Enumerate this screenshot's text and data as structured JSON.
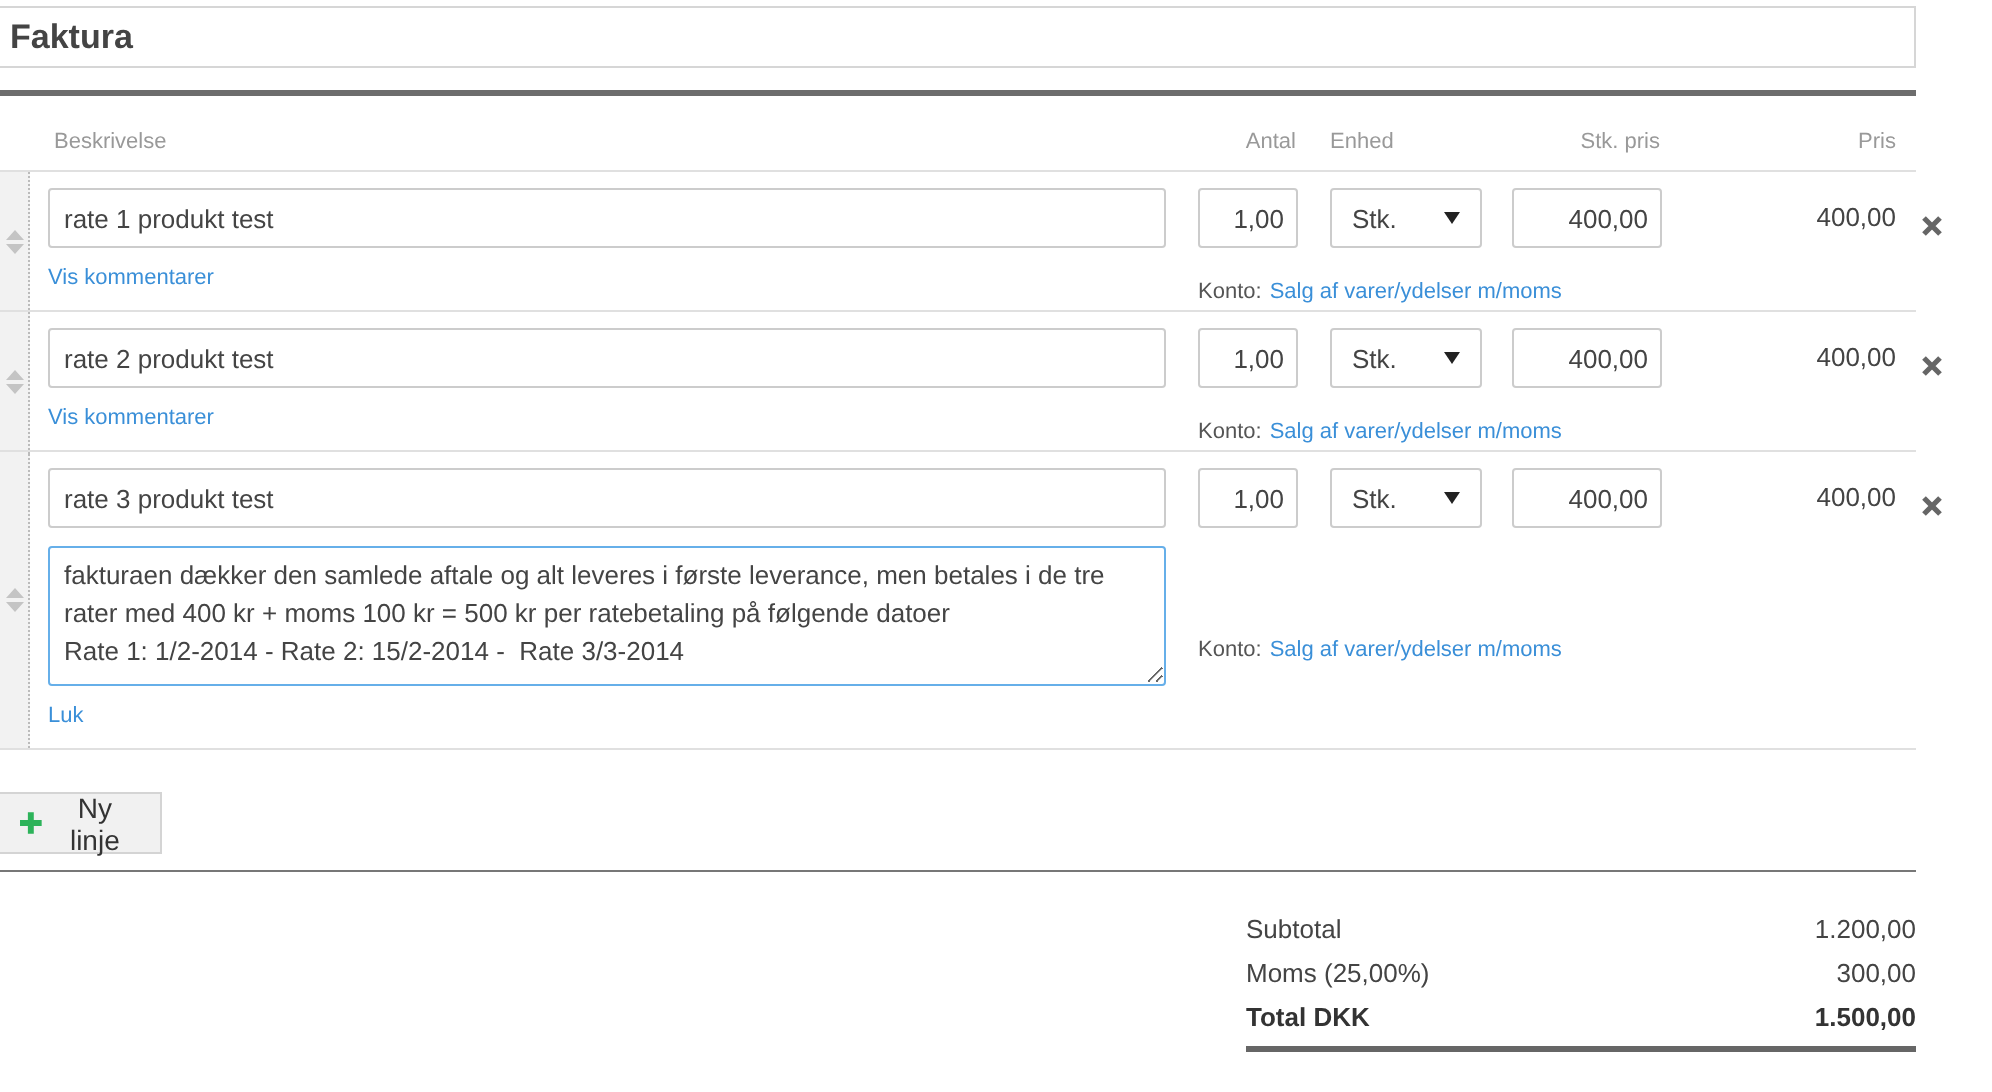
{
  "title_field": {
    "value": "Faktura"
  },
  "columns": [
    "Beskrivelse",
    "Antal",
    "Enhed",
    "Stk. pris",
    "Pris"
  ],
  "rows": [
    {
      "description": "rate 1 produkt test",
      "quantity": "1,00",
      "unit": "Stk.",
      "unit_price": "400,00",
      "price": "400,00",
      "comment_link": "Vis kommentarer",
      "account_label": "Konto:",
      "account": "Salg af varer/ydelser m/moms"
    },
    {
      "description": "rate 2 produkt test",
      "quantity": "1,00",
      "unit": "Stk.",
      "unit_price": "400,00",
      "price": "400,00",
      "comment_link": "Vis kommentarer",
      "account_label": "Konto:",
      "account": "Salg af varer/ydelser m/moms"
    },
    {
      "description": "rate 3 produkt test",
      "quantity": "1,00",
      "unit": "Stk.",
      "unit_price": "400,00",
      "price": "400,00",
      "comment": "fakturaen dækker den samlede aftale og alt leveres i første leverance, men betales i de tre rater med 400 kr + moms 100 kr = 500 kr per ratebetaling på følgende datoer\nRate 1: 1/2-2014 - Rate 2: 15/2-2014 -  Rate 3/3-2014",
      "comment_link": "Luk",
      "account_label": "Konto:",
      "account": "Salg af varer/ydelser m/moms"
    }
  ],
  "add_button": "Ny linje",
  "totals": [
    {
      "label": "Subtotal",
      "value": "1.200,00",
      "kind": "plain"
    },
    {
      "label": "Moms (25,00%)",
      "value": "300,00",
      "kind": "plain"
    },
    {
      "label": "Total DKK",
      "value": "1.500,00",
      "kind": "total"
    }
  ]
}
